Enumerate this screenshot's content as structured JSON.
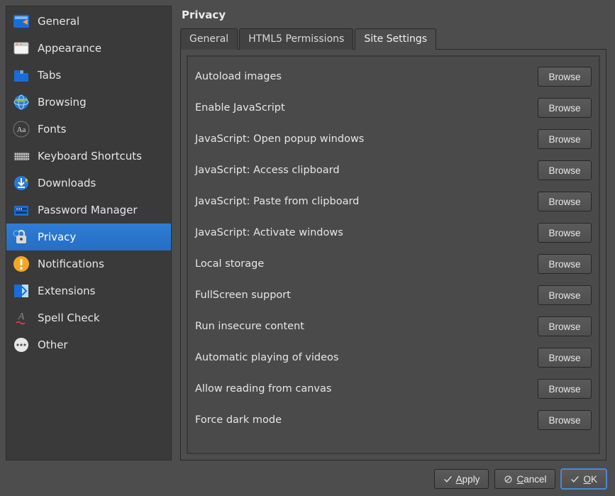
{
  "page_title": "Privacy",
  "sidebar": {
    "items": [
      {
        "label": "General",
        "icon": "general"
      },
      {
        "label": "Appearance",
        "icon": "appearance"
      },
      {
        "label": "Tabs",
        "icon": "tabs"
      },
      {
        "label": "Browsing",
        "icon": "browsing"
      },
      {
        "label": "Fonts",
        "icon": "fonts"
      },
      {
        "label": "Keyboard Shortcuts",
        "icon": "keyboard"
      },
      {
        "label": "Downloads",
        "icon": "downloads"
      },
      {
        "label": "Password Manager",
        "icon": "password"
      },
      {
        "label": "Privacy",
        "icon": "privacy",
        "selected": true
      },
      {
        "label": "Notifications",
        "icon": "notifications"
      },
      {
        "label": "Extensions",
        "icon": "extensions"
      },
      {
        "label": "Spell Check",
        "icon": "spellcheck"
      },
      {
        "label": "Other",
        "icon": "other"
      }
    ]
  },
  "tabs": [
    {
      "label": "General"
    },
    {
      "label": "HTML5 Permissions"
    },
    {
      "label": "Site Settings",
      "active": true
    }
  ],
  "settings": [
    {
      "label": "Autoload images"
    },
    {
      "label": "Enable JavaScript"
    },
    {
      "label": "JavaScript: Open popup windows"
    },
    {
      "label": "JavaScript: Access clipboard"
    },
    {
      "label": "JavaScript: Paste from clipboard"
    },
    {
      "label": "JavaScript: Activate windows"
    },
    {
      "label": "Local storage"
    },
    {
      "label": "FullScreen support"
    },
    {
      "label": "Run insecure content"
    },
    {
      "label": "Automatic playing of videos"
    },
    {
      "label": "Allow reading from canvas"
    },
    {
      "label": "Force dark mode"
    }
  ],
  "browse_label": "Browse",
  "footer": {
    "apply": "Apply",
    "cancel": "Cancel",
    "ok": "OK"
  }
}
